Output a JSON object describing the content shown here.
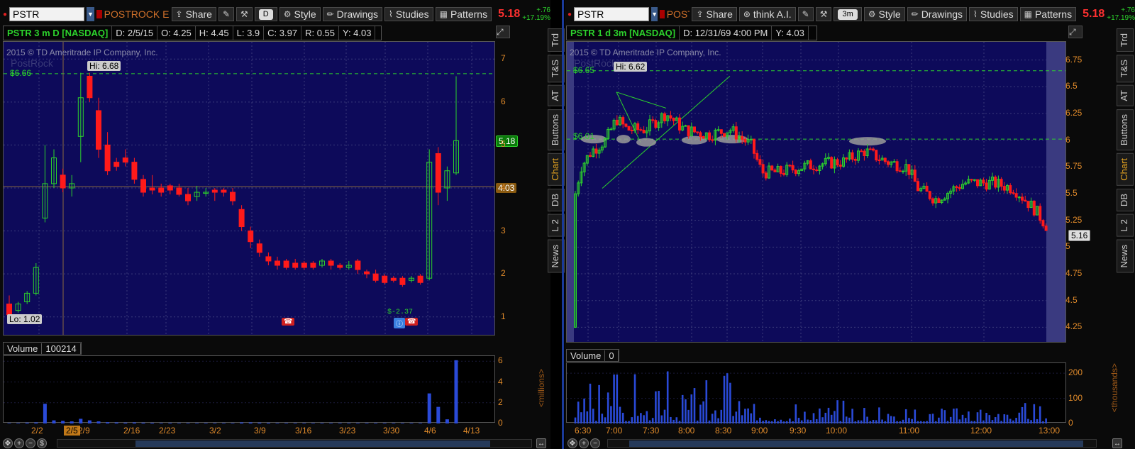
{
  "left": {
    "toolbar": {
      "symbol": "PSTR",
      "company": "POSTROCK EN...",
      "share": "Share",
      "aggregation": "D",
      "style": "Style",
      "drawings": "Drawings",
      "studies": "Studies",
      "patterns": "Patterns",
      "price": "5.18",
      "change": "+.76",
      "change_pct": "+17.19%"
    },
    "header": {
      "title": "PSTR 3 m D [NASDAQ]",
      "date": "D: 2/5/15",
      "open": "O: 4.25",
      "high": "H: 4.45",
      "low": "L: 3.9",
      "close": "C: 3.97",
      "range": "R: 0.55",
      "y": "Y: 4.03"
    },
    "copyright": "2015 © TD Ameritrade IP Company, Inc.",
    "watermark": "PostRock",
    "hi_label": "Hi: 6.68",
    "lo_label": "Lo: 1.02",
    "level_label": "$6.66",
    "last_price_tag": "5.18",
    "prev_close_tag": "4.03",
    "dividend_label": "$-2.37",
    "y_ticks": [
      "7",
      "6",
      "5",
      "4",
      "3",
      "2",
      "1"
    ],
    "volume": {
      "label": "Volume",
      "value": "100214",
      "ticks": [
        "6",
        "4",
        "2",
        "0"
      ],
      "unit": "<millions>"
    },
    "x_ticks": [
      "2/2",
      "2/5",
      "2/9",
      "2/16",
      "2/23",
      "3/2",
      "3/9",
      "3/16",
      "3/23",
      "3/30",
      "4/6",
      "4/13"
    ],
    "side_tabs": [
      "Trd",
      "T&S",
      "AT",
      "Buttons",
      "Chart",
      "DB",
      "L 2",
      "News"
    ]
  },
  "right": {
    "toolbar": {
      "symbol": "PSTR",
      "company": "POST...",
      "share": "Share",
      "thinkai": "think A.I.",
      "aggregation": "3m",
      "style": "Style",
      "drawings": "Drawings",
      "studies": "Studies",
      "patterns": "Patterns",
      "price": "5.18",
      "change": "+.76",
      "change_pct": "+17.19%"
    },
    "header": {
      "title": "PSTR 1 d 3m [NASDAQ]",
      "date": "D: 12/31/69 4:00 PM",
      "y": "Y: 4.03"
    },
    "copyright": "2015 © TD Ameritrade IP Company, Inc.",
    "watermark": "PostRock",
    "hi_label": "Hi: 6.62",
    "level_top": "$6.65",
    "level_mid": "$6.01",
    "last_price_tag": "5.16",
    "y_ticks": [
      "6.75",
      "6.5",
      "6.25",
      "6",
      "5.75",
      "5.5",
      "5.25",
      "5",
      "4.75",
      "4.5",
      "4.25"
    ],
    "volume": {
      "label": "Volume",
      "value": "0",
      "ticks": [
        "200",
        "100",
        "0"
      ],
      "unit": "<thousands>"
    },
    "x_ticks": [
      "6:30",
      "7:00",
      "7:30",
      "8:00",
      "8:30",
      "9:00",
      "9:30",
      "10:00",
      "11:00",
      "12:00",
      "13:00"
    ],
    "side_tabs": [
      "Trd",
      "T&S",
      "AT",
      "Buttons",
      "Chart",
      "DB",
      "L 2",
      "News"
    ]
  },
  "colors": {
    "bg": "#0d0a5a",
    "up": "#2cd22c",
    "down": "#ff1a1a",
    "axis": "#e08a2a"
  }
}
